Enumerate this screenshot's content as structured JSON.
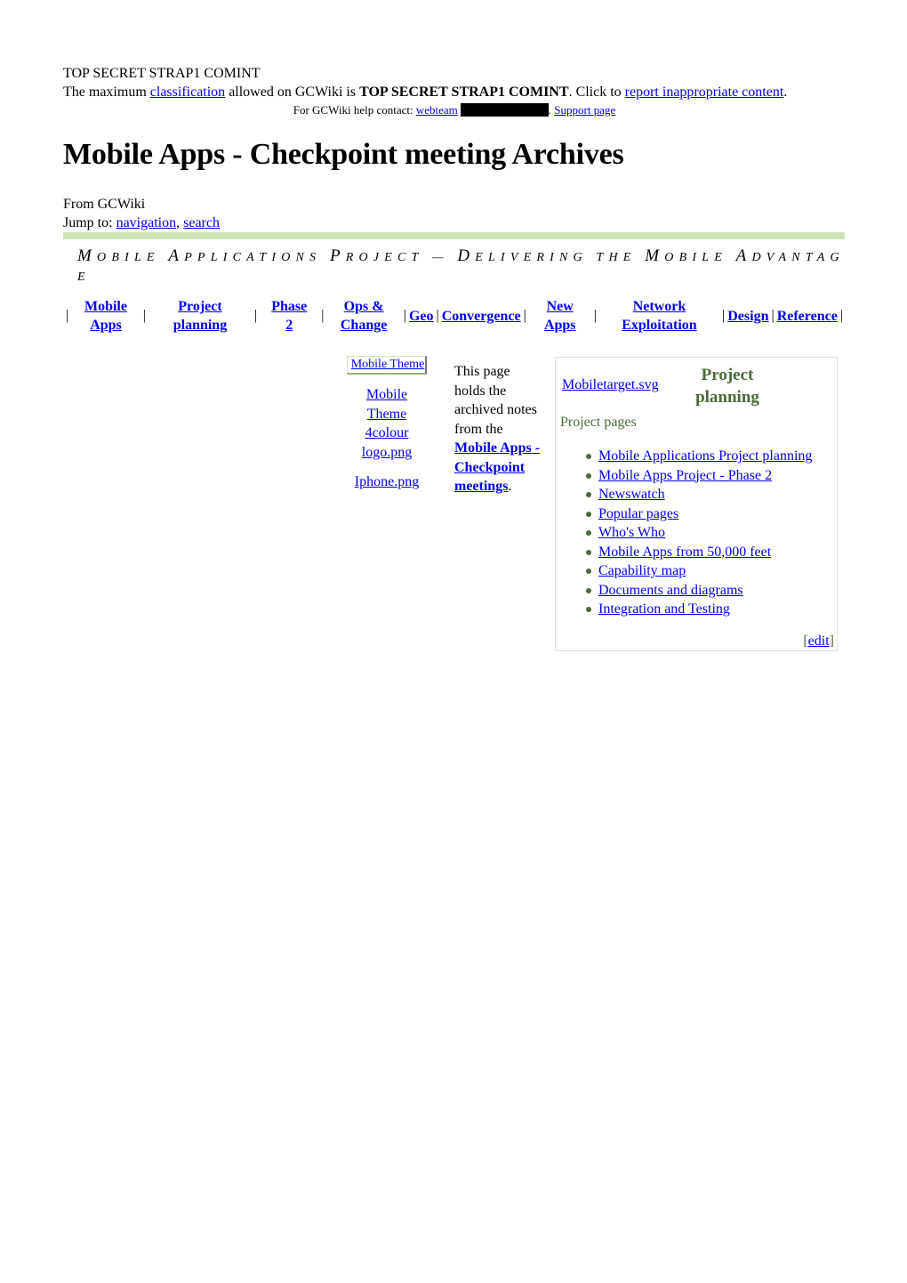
{
  "header": {
    "classification_label": "TOP SECRET STRAP1 COMINT",
    "banner": {
      "prefix": "The maximum ",
      "classification_link": "classification",
      "middle": " allowed on GCWiki is ",
      "level": "TOP SECRET STRAP1 COMINT",
      "suffix": ". Click to ",
      "report_link": "report inappropriate content",
      "end": "."
    },
    "help": {
      "prefix": "For GCWiki help contact: ",
      "webteam_link": "webteam",
      "after_redaction": ". ",
      "support_link": "Support page"
    }
  },
  "page": {
    "title": "Mobile Apps - Checkpoint meeting Archives",
    "from": "From GCWiki",
    "jump_prefix": "Jump to: ",
    "jump_navigation": "navigation",
    "jump_comma": ", ",
    "jump_search": "search",
    "accent_bar_color": "#cfe5b8"
  },
  "tagline": {
    "parts": [
      {
        "cap": "M",
        "rest": "OBILE "
      },
      {
        "cap": "A",
        "rest": "PPLICATIONS "
      },
      {
        "cap": "P",
        "rest": "ROJECT "
      },
      {
        "cap": "",
        "rest": "— "
      },
      {
        "cap": "D",
        "rest": "ELIVERING THE "
      },
      {
        "cap": "M",
        "rest": "OBILE "
      },
      {
        "cap": "A",
        "rest": "DVANTAGE"
      }
    ]
  },
  "navbar": {
    "items": [
      {
        "line1": "Mobile",
        "line2": "Apps"
      },
      {
        "line1": "Project",
        "line2": "planning"
      },
      {
        "line1": "Phase",
        "line2": "2"
      },
      {
        "line1": "Ops &",
        "line2": "Change"
      },
      {
        "line1": "Geo",
        "line2": ""
      },
      {
        "line1": "Convergence",
        "line2": ""
      },
      {
        "line1": "New",
        "line2": "Apps"
      },
      {
        "line1": "Network",
        "line2": "Exploitation"
      },
      {
        "line1": "Design",
        "line2": ""
      },
      {
        "line1": "Reference",
        "line2": ""
      }
    ],
    "separator": "|"
  },
  "thumbnails": {
    "theme_box_label": "Mobile Theme",
    "logo_link": "Mobile Theme 4colour logo.png",
    "logo_lines": [
      "Mobile",
      "Theme",
      "4colour",
      "logo.png"
    ],
    "iphone_link": "Iphone.png"
  },
  "intro": {
    "before": "This page holds the archived notes from the ",
    "link": "Mobile Apps - Checkpoint meetings",
    "after": "."
  },
  "project_box": {
    "image_link": "Mobiletarget.svg",
    "title_line1": "Project",
    "title_line2": "planning",
    "subtitle": "Project pages",
    "links": [
      "Mobile Applications Project planning",
      "Mobile Apps Project - Phase 2",
      "Newswatch",
      "Popular pages",
      "Who's Who",
      "Mobile Apps from 50,000 feet",
      "Capability map",
      "Documents and diagrams",
      "Integration and Testing"
    ],
    "edit_open": "[",
    "edit_link": "edit",
    "edit_close": "]",
    "title_color": "#4a6a3a"
  }
}
